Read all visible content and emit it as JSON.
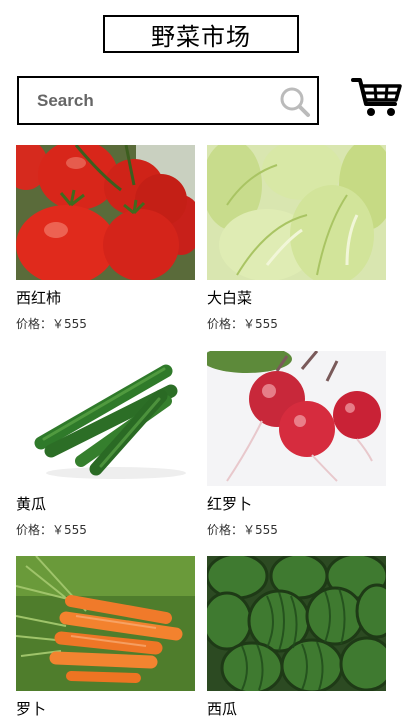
{
  "header": {
    "title": "野菜市场"
  },
  "search": {
    "placeholder": "Search",
    "icon": "search-icon"
  },
  "cart": {
    "icon": "shopping-cart-icon"
  },
  "products": [
    {
      "name": "西红柿",
      "price": "价格：￥555",
      "image": "tomato-photo"
    },
    {
      "name": "大白菜",
      "price": "价格：￥555",
      "image": "napa-cabbage-photo"
    },
    {
      "name": "黄瓜",
      "price": "价格：￥555",
      "image": "cucumber-photo"
    },
    {
      "name": "红罗卜",
      "price": "价格：￥555",
      "image": "red-radish-photo"
    },
    {
      "name": "罗卜",
      "price": "",
      "image": "carrot-photo"
    },
    {
      "name": "西瓜",
      "price": "",
      "image": "watermelon-photo"
    }
  ]
}
